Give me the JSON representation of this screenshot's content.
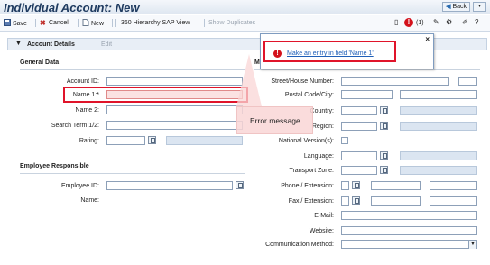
{
  "window": {
    "title": "Individual Account: New",
    "back_label": "Back",
    "menu_label": "▾"
  },
  "toolbar": {
    "save_label": "Save",
    "cancel_label": "Cancel",
    "new_label": "New",
    "hierarchy_label": "360 Hierarchy SAP View",
    "show_duplicates_label": "Show Duplicates",
    "message_count": "(1)"
  },
  "section": {
    "title": "Account Details",
    "edit_label": "Edit"
  },
  "general": {
    "title": "General Data",
    "account_id_label": "Account ID:",
    "name1_label": "Name 1:*",
    "name2_label": "Name 2:",
    "search_term_label": "Search Term 1/2:",
    "rating_label": "Rating:"
  },
  "employee": {
    "title": "Employee Responsible",
    "employee_id_label": "Employee ID:",
    "name_label": "Name:"
  },
  "address": {
    "title": "Ma",
    "street_label": "Street/House Number:",
    "postal_label": "Postal Code/City:",
    "country_label": "Country:",
    "region_label": "Region:",
    "national_label": "National Version(s):",
    "language_label": "Language:",
    "transport_label": "Transport Zone:",
    "phone_label": "Phone / Extension:",
    "fax_label": "Fax / Extension:",
    "email_label": "E-Mail:",
    "website_label": "Website:",
    "comm_method_label": "Communication Method:"
  },
  "popup": {
    "message_link": "Make an entry in field 'Name 1'",
    "close_label": "×"
  },
  "annotation": {
    "text": "Error message"
  },
  "colors": {
    "error_red": "#e0142a",
    "title_blue": "#1f3b60",
    "link_blue": "#1f5fb8"
  }
}
